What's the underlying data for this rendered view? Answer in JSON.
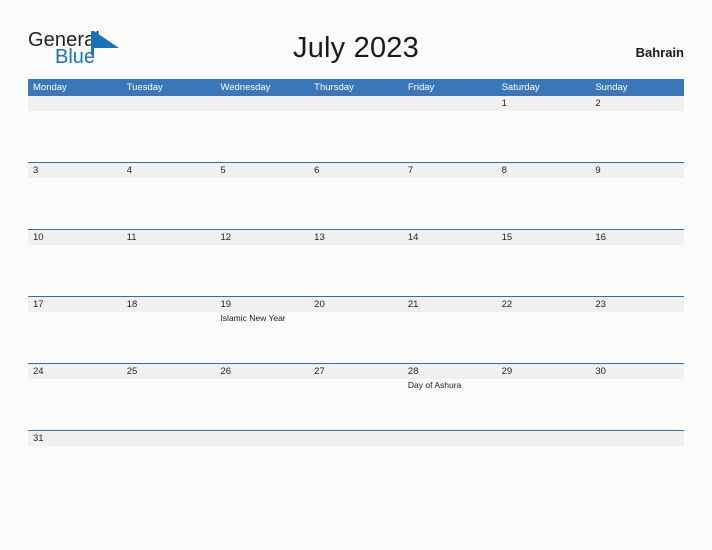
{
  "brand": {
    "name_part1": "General",
    "name_part2": "Blue",
    "flag_icon": "blue-flag-triangle",
    "color_dark": "#231f20",
    "color_blue": "#1b72b8"
  },
  "header": {
    "title": "July 2023",
    "country": "Bahrain"
  },
  "theme": {
    "header_blue": "#3b77b8",
    "row_divider_blue": "#2f6fa8",
    "day_band_gray": "#f0f0f0",
    "page_background": "#fbfbfa"
  },
  "calendar": {
    "day_headers": [
      "Monday",
      "Tuesday",
      "Wednesday",
      "Thursday",
      "Friday",
      "Saturday",
      "Sunday"
    ],
    "weeks": [
      {
        "short": false,
        "days": [
          {
            "num": "",
            "events": []
          },
          {
            "num": "",
            "events": []
          },
          {
            "num": "",
            "events": []
          },
          {
            "num": "",
            "events": []
          },
          {
            "num": "",
            "events": []
          },
          {
            "num": "1",
            "events": []
          },
          {
            "num": "2",
            "events": []
          }
        ]
      },
      {
        "short": false,
        "days": [
          {
            "num": "3",
            "events": []
          },
          {
            "num": "4",
            "events": []
          },
          {
            "num": "5",
            "events": []
          },
          {
            "num": "6",
            "events": []
          },
          {
            "num": "7",
            "events": []
          },
          {
            "num": "8",
            "events": []
          },
          {
            "num": "9",
            "events": []
          }
        ]
      },
      {
        "short": false,
        "days": [
          {
            "num": "10",
            "events": []
          },
          {
            "num": "11",
            "events": []
          },
          {
            "num": "12",
            "events": []
          },
          {
            "num": "13",
            "events": []
          },
          {
            "num": "14",
            "events": []
          },
          {
            "num": "15",
            "events": []
          },
          {
            "num": "16",
            "events": []
          }
        ]
      },
      {
        "short": false,
        "days": [
          {
            "num": "17",
            "events": []
          },
          {
            "num": "18",
            "events": []
          },
          {
            "num": "19",
            "events": [
              "Islamic New Year"
            ]
          },
          {
            "num": "20",
            "events": []
          },
          {
            "num": "21",
            "events": []
          },
          {
            "num": "22",
            "events": []
          },
          {
            "num": "23",
            "events": []
          }
        ]
      },
      {
        "short": false,
        "days": [
          {
            "num": "24",
            "events": []
          },
          {
            "num": "25",
            "events": []
          },
          {
            "num": "26",
            "events": []
          },
          {
            "num": "27",
            "events": []
          },
          {
            "num": "28",
            "events": [
              "Day of Ashura"
            ]
          },
          {
            "num": "29",
            "events": []
          },
          {
            "num": "30",
            "events": []
          }
        ]
      },
      {
        "short": true,
        "days": [
          {
            "num": "31",
            "events": []
          },
          {
            "num": "",
            "events": []
          },
          {
            "num": "",
            "events": []
          },
          {
            "num": "",
            "events": []
          },
          {
            "num": "",
            "events": []
          },
          {
            "num": "",
            "events": []
          },
          {
            "num": "",
            "events": []
          }
        ]
      }
    ]
  }
}
